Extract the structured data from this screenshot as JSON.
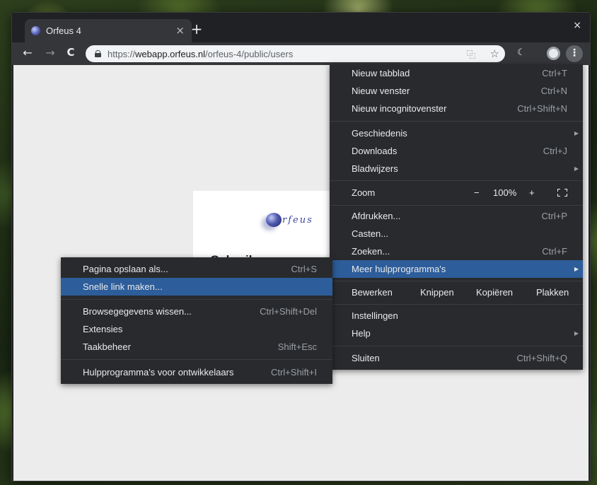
{
  "browser": {
    "tab_title": "Orfeus 4",
    "tab_close": "×",
    "new_tab": "+",
    "window_close": "×",
    "nav": {
      "back": "←",
      "forward": "→",
      "reload": "C"
    },
    "url": {
      "scheme": "https://",
      "host": "webapp.orfeus.nl",
      "path": "/orfeus-4/public/users"
    },
    "omnibox_icons": [
      "translate-icon",
      "star-icon"
    ],
    "toolbar_icons": [
      "extension-icon",
      "avatar",
      "menu-icon"
    ],
    "menu_button": "⋮",
    "translate_glyph": "⿻",
    "star_glyph": "☆",
    "extension_glyph": "☾"
  },
  "page": {
    "logo_text": "rfeus",
    "heading_partial": "Gebruik"
  },
  "main_menu": {
    "items": [
      {
        "label": "Nieuw tabblad",
        "shortcut": "Ctrl+T"
      },
      {
        "label": "Nieuw venster",
        "shortcut": "Ctrl+N"
      },
      {
        "label": "Nieuw incognitovenster",
        "shortcut": "Ctrl+Shift+N"
      },
      {
        "label": "Geschiedenis",
        "shortcut": "",
        "submenu": true
      },
      {
        "label": "Downloads",
        "shortcut": "Ctrl+J"
      },
      {
        "label": "Bladwijzers",
        "shortcut": "",
        "submenu": true
      },
      {
        "label": "Afdrukken...",
        "shortcut": "Ctrl+P"
      },
      {
        "label": "Casten...",
        "shortcut": ""
      },
      {
        "label": "Zoeken...",
        "shortcut": "Ctrl+F"
      },
      {
        "label": "Meer hulpprogramma's",
        "shortcut": "",
        "submenu": true,
        "highlighted": true
      },
      {
        "label": "Instellingen",
        "shortcut": ""
      },
      {
        "label": "Help",
        "shortcut": "",
        "submenu": true
      },
      {
        "label": "Sluiten",
        "shortcut": "Ctrl+Shift+Q"
      }
    ],
    "zoom": {
      "label": "Zoom",
      "minus": "−",
      "value": "100%",
      "plus": "+"
    },
    "edit": {
      "label": "Bewerken",
      "cut": "Knippen",
      "copy": "Kopiëren",
      "paste": "Plakken"
    },
    "submenu_arrow": "▶"
  },
  "sub_menu": {
    "items": [
      {
        "label": "Pagina opslaan als...",
        "shortcut": "Ctrl+S"
      },
      {
        "label": "Snelle link maken...",
        "shortcut": "",
        "highlighted": true
      },
      {
        "label": "Browsegegevens wissen...",
        "shortcut": "Ctrl+Shift+Del"
      },
      {
        "label": "Extensies",
        "shortcut": ""
      },
      {
        "label": "Taakbeheer",
        "shortcut": "Shift+Esc"
      },
      {
        "label": "Hulpprogramma's voor ontwikkelaars",
        "shortcut": "Ctrl+Shift+I"
      }
    ]
  },
  "colors": {
    "menu_bg": "#292a2d",
    "highlight": "#2d5d9a",
    "page_bg": "#ececec",
    "toolbar": "#35363a"
  }
}
